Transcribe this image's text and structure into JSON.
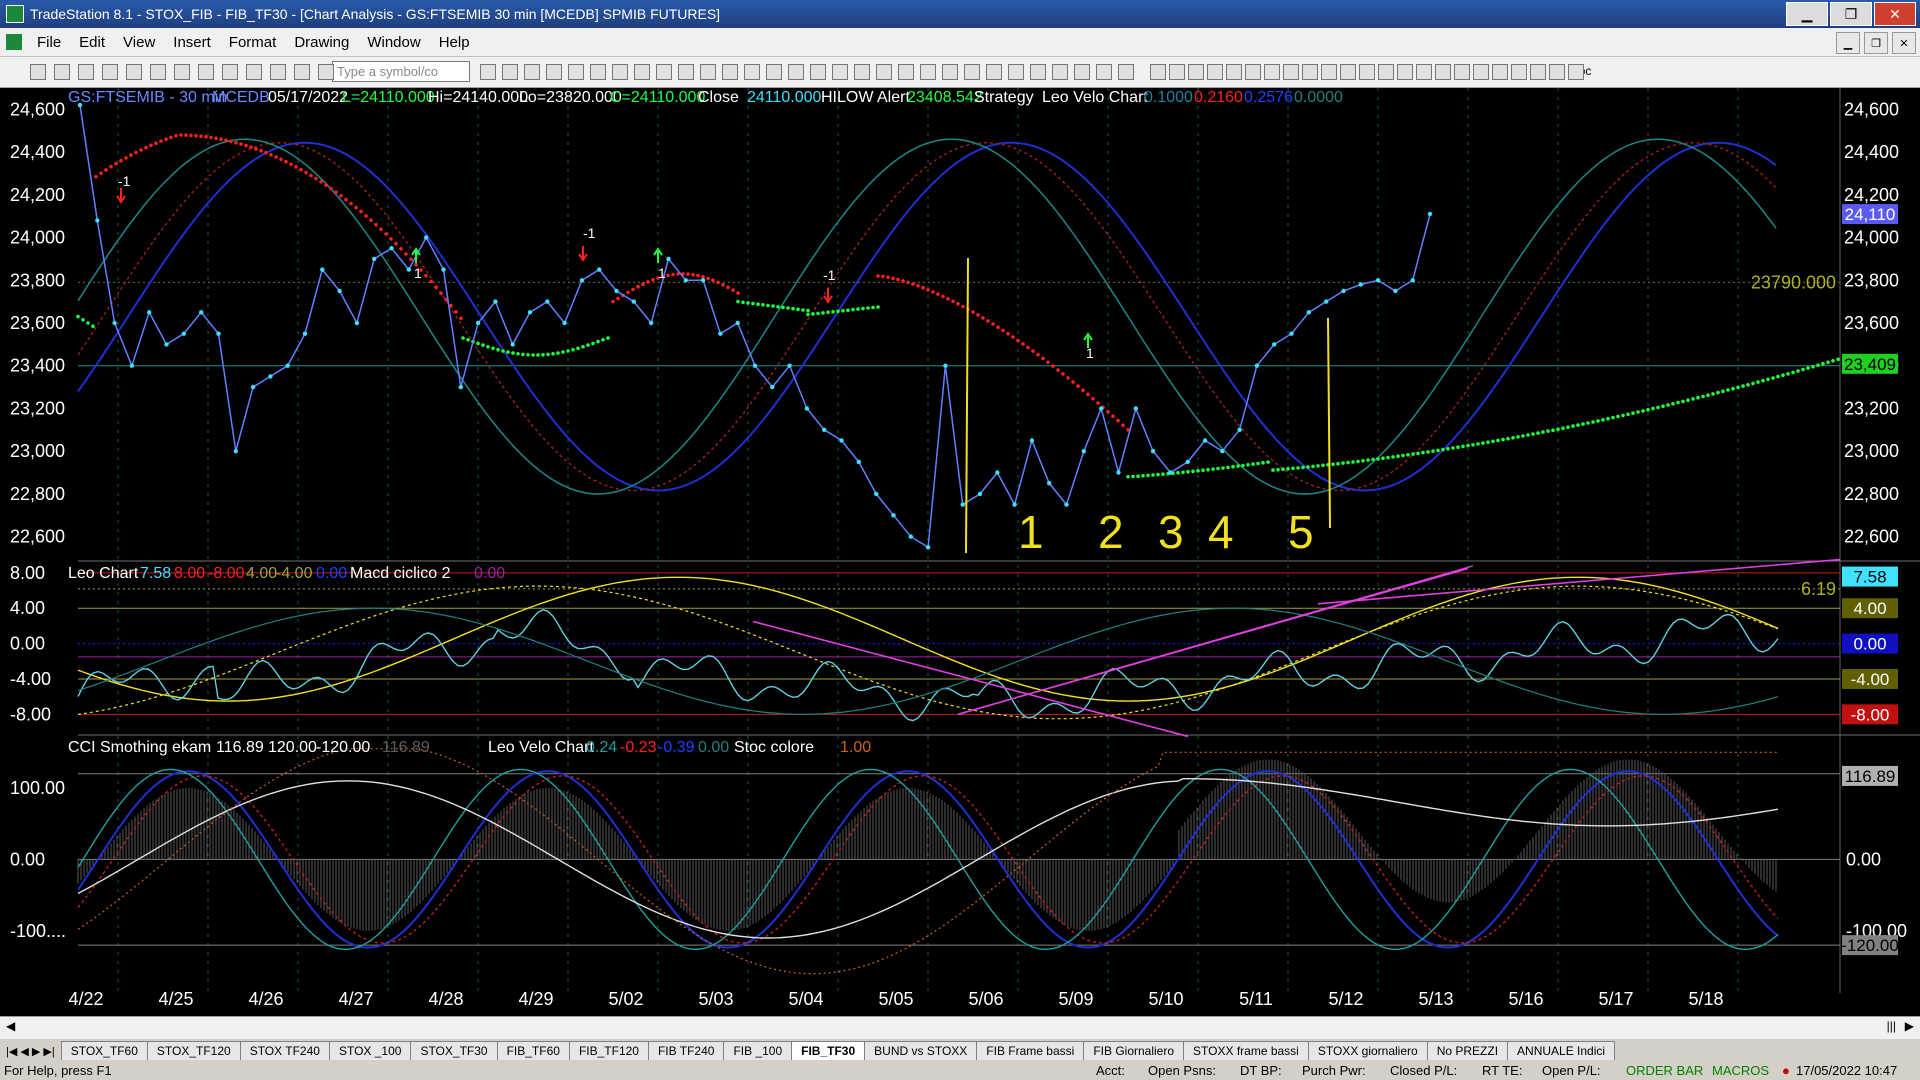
{
  "window": {
    "title": "TradeStation 8.1 - STOX_FIB - FIB_TF30 - [Chart Analysis - GS:FTSEMIB 30 min [MCEDB] SPMIB FUTURES]",
    "minimize": "▁",
    "restore": "❐",
    "close": "✕"
  },
  "menu": [
    "File",
    "Edit",
    "View",
    "Insert",
    "Format",
    "Drawing",
    "Window",
    "Help"
  ],
  "toolbar": {
    "symbol_placeholder": "Type a symbol/co",
    "abc_label": "abc"
  },
  "header": {
    "symbol": "GS:FTSEMIB - 30 min",
    "feed": "MCEDB",
    "date": "05/17/2022",
    "last": "L=24110.000",
    "hi": "Hi=24140.000",
    "lo": "Lo=23820.000",
    "close_val": "C=24110.000",
    "close_label": "Close",
    "close_num": "24110.000",
    "hilow_label": "HILOW Alert",
    "hilow_val": "23408.542",
    "strategy_label": "Strategy",
    "velo_label": "Leo Velo Chart",
    "velo_v1": "0.1000",
    "velo_v2": "0.2160",
    "velo_v3": "0.2576",
    "velo_v4": "0.0000"
  },
  "panel2_header": {
    "name": "Leo Chart",
    "v1": "7.58",
    "v2": "8.00",
    "v3": "-8.00",
    "v4": "4.00",
    "v5": "-4.00",
    "v6": "0.00",
    "macd_label": "Macd ciclico 2",
    "macd_val": "0.00"
  },
  "panel3_header": {
    "name": "CCI Smothing ekam",
    "v1": "116.89",
    "v2": "120.00",
    "v3": "-120.00",
    "v4": "116.89",
    "velo_label": "Leo Velo Chart",
    "velo_v1": "0.24",
    "velo_v2": "-0.23",
    "velo_v3": "-0.39",
    "velo_v4": "0.00",
    "stoc_label": "Stoc colore",
    "stoc_val": "1.00"
  },
  "colors": {
    "price": "#40e0ff",
    "red_trail": "#ff2020",
    "green_trail": "#20ff40",
    "cycle_blue": "#2030d0",
    "cycle_teal": "#208080",
    "yellow": "#f0e020",
    "magenta": "#e040e0",
    "white_line": "#e0e0e0"
  },
  "chart_data": [
    {
      "type": "line",
      "title": "GS:FTSEMIB - 30 min",
      "x": [
        "4/22",
        "4/25",
        "4/26",
        "4/27",
        "4/28",
        "4/29",
        "5/02",
        "5/03",
        "5/04",
        "5/05",
        "5/06",
        "5/09",
        "5/10",
        "5/11",
        "5/12",
        "5/13",
        "5/16",
        "5/17",
        "5/18"
      ],
      "ylim": [
        22500,
        24700
      ],
      "yticks": [
        "24,600",
        "24,400",
        "24,200",
        "24,000",
        "23,800",
        "23,600",
        "23,400",
        "23,200",
        "23,000",
        "22,800",
        "22,600"
      ],
      "series": [
        {
          "name": "Close",
          "values": [
            24620,
            24080,
            23600,
            23400,
            23650,
            23500,
            23550,
            23650,
            23550,
            23000,
            23300,
            23350,
            23400,
            23550,
            23850,
            23750,
            23600,
            23900,
            23950,
            23850,
            24000,
            23850,
            23300,
            23600,
            23700,
            23500,
            23650,
            23700,
            23600,
            23800,
            23850,
            23750,
            23700,
            23600,
            23900,
            23800,
            23800,
            23550,
            23600,
            23400,
            23300,
            23400,
            23200,
            23100,
            23050,
            22950,
            22800,
            22700,
            22600,
            22550,
            23400,
            22750,
            22800,
            22900,
            22750,
            23050,
            22850,
            22750,
            23000,
            23200,
            22900,
            23200,
            23000,
            22900,
            22950,
            23050,
            23000,
            23100,
            23400,
            23500,
            23550,
            23650,
            23700,
            23750,
            23780,
            23800,
            23750,
            23800,
            24110
          ]
        }
      ],
      "annotations": [
        "-1",
        "1",
        "-1",
        "1",
        "-1",
        "1",
        "1",
        "2",
        "3",
        "4",
        "5"
      ],
      "reference_level": "23790.000",
      "right_labels": {
        "last": "24,110",
        "hilow": "23,409"
      }
    },
    {
      "type": "line",
      "title": "Leo Chart",
      "ylim": [
        -10,
        9
      ],
      "yticks": [
        "8.00",
        "4.00",
        "0.00",
        "-4.00",
        "-8.00"
      ],
      "right_labels": [
        "7.58",
        "4.00",
        "0.00",
        "-4.00",
        "-8.00"
      ],
      "trend_label": "6.19"
    },
    {
      "type": "line",
      "title": "CCI Smothing ekam",
      "ylim": [
        -180,
        170
      ],
      "yticks": [
        "100.00",
        "0.00",
        "-100...."
      ],
      "right_labels": [
        "116.89",
        "0.00",
        "-100.00",
        "-120.00"
      ]
    }
  ],
  "tabs": [
    "STOX_TF60",
    "STOX_TF120",
    "STOX TF240",
    "STOX _100",
    "STOX_TF30",
    "FIB_TF60",
    "FIB_TF120",
    "FIB TF240",
    "FIB _100",
    "FIB_TF30",
    "BUND vs STOXX",
    "FIB Frame bassi",
    "FIB Giornaliero",
    "STOXX frame bassi",
    "STOXX giornaliero",
    "No PREZZI",
    "ANNUALE Indici"
  ],
  "active_tab": "FIB_TF30",
  "status": {
    "help": "For Help, press F1",
    "acct": "Acct:",
    "open_psns": "Open Psns:",
    "dt_bp": "DT BP:",
    "purch_pwr": "Purch Pwr:",
    "closed_pl": "Closed P/L:",
    "rt_te": "RT TE:",
    "open_pl": "Open P/L:",
    "order_bar": "ORDER BAR",
    "macros": "MACROS",
    "datetime": "17/05/2022 10:47"
  }
}
